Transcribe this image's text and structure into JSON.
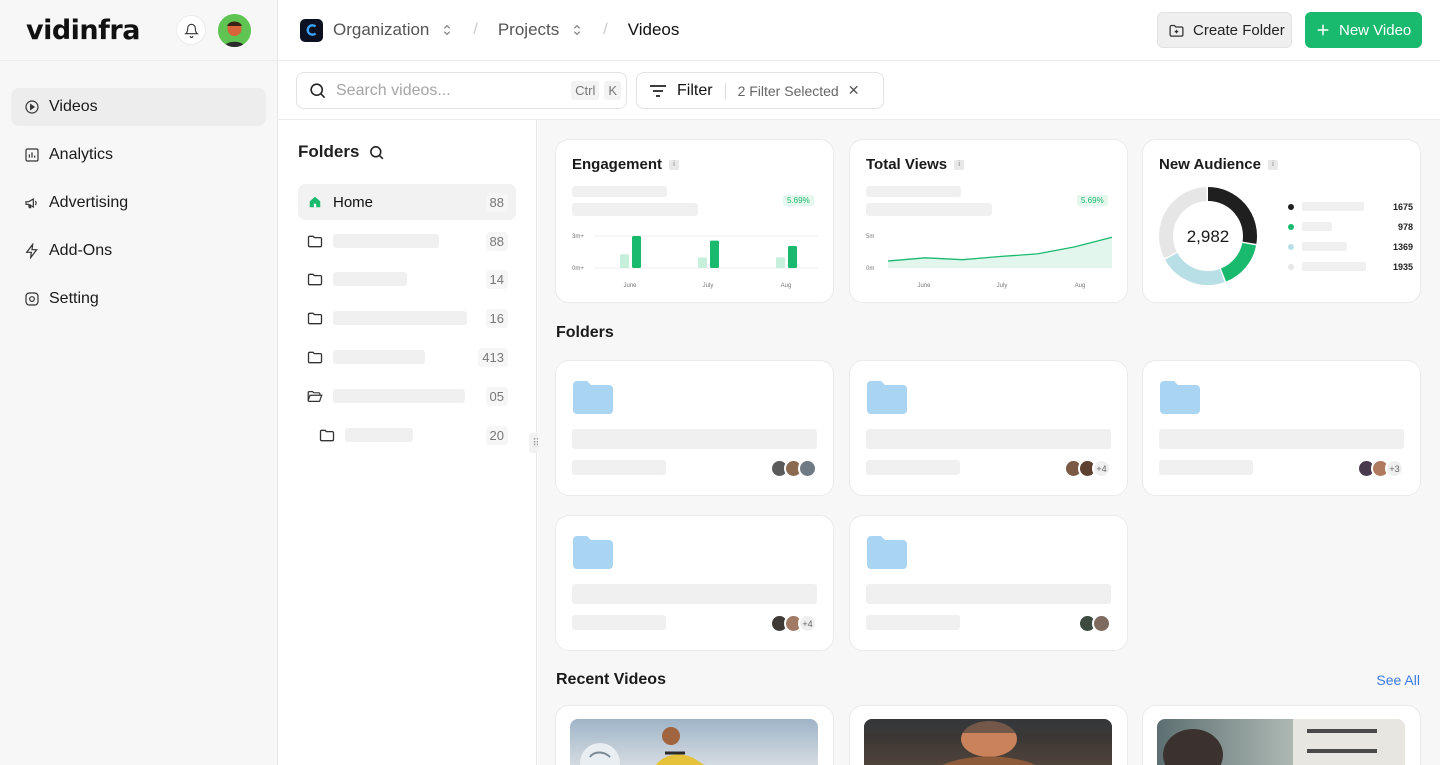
{
  "brand": {
    "name": "vidinfra"
  },
  "sidebar": {
    "items": [
      {
        "label": "Videos",
        "icon": "play-circle-icon",
        "active": true
      },
      {
        "label": "Analytics",
        "icon": "bar-chart-icon",
        "active": false
      },
      {
        "label": "Advertising",
        "icon": "megaphone-icon",
        "active": false
      },
      {
        "label": "Add-Ons",
        "icon": "bolt-icon",
        "active": false
      },
      {
        "label": "Setting",
        "icon": "settings-icon",
        "active": false
      }
    ]
  },
  "breadcrumb": {
    "organization": "Organization",
    "projects": "Projects",
    "current": "Videos"
  },
  "header": {
    "create_folder": "Create Folder",
    "new_video": "New Video"
  },
  "search": {
    "placeholder": "Search videos...",
    "shortcut_mod": "Ctrl",
    "shortcut_key": "K"
  },
  "filter": {
    "label": "Filter",
    "selected": "2 Filter Selected"
  },
  "folders_panel": {
    "title": "Folders",
    "home": {
      "label": "Home",
      "count": "88"
    },
    "rows": [
      {
        "count": "88"
      },
      {
        "count": "14"
      },
      {
        "count": "16"
      },
      {
        "count": "413"
      },
      {
        "count": "05"
      },
      {
        "count": "20"
      }
    ]
  },
  "stats": {
    "engagement": {
      "title": "Engagement",
      "change": "5.69%",
      "y_top": "3m+",
      "y_bottom": "0m+",
      "months": [
        "June",
        "July",
        "Aug"
      ]
    },
    "total_views": {
      "title": "Total Views",
      "change": "5.69%",
      "y_top": "5m",
      "y_bottom": "0m",
      "months": [
        "June",
        "July",
        "Aug"
      ]
    },
    "new_audience": {
      "title": "New Audience",
      "total": "2,982",
      "legend_values": [
        "1675",
        "978",
        "1369",
        "1935"
      ]
    }
  },
  "sections": {
    "folders": "Folders",
    "recent_videos": "Recent Videos",
    "see_all": "See All"
  },
  "folder_tiles": [
    {
      "more": ""
    },
    {
      "more": "+4"
    },
    {
      "more": "+3"
    },
    {
      "more": "+4"
    },
    {
      "more": ""
    }
  ],
  "colors": {
    "accent": "#19b96e",
    "folder": "#a9d4f2",
    "link": "#3b7be0"
  },
  "chart_data": [
    {
      "type": "bar",
      "title": "Engagement",
      "categories": [
        "June",
        "July",
        "Aug"
      ],
      "series": [
        {
          "values": [
            0.45,
            0.35,
            0.35
          ]
        },
        {
          "values": [
            1.05,
            0.9,
            0.72
          ]
        }
      ],
      "ylim": [
        0,
        1.05
      ],
      "yticks": [
        "0m+",
        "3m+"
      ]
    },
    {
      "type": "area",
      "title": "Total Views",
      "x": [
        "June",
        "July",
        "Aug"
      ],
      "y": [
        1.1,
        1.6,
        1.3,
        1.8,
        2.2,
        3.3,
        4.8
      ],
      "ylim": [
        0,
        5
      ],
      "yticks": [
        "0m",
        "5m"
      ]
    },
    {
      "type": "pie",
      "title": "New Audience",
      "center_label": "2,982",
      "values": [
        1675,
        978,
        1369,
        1935
      ]
    }
  ]
}
